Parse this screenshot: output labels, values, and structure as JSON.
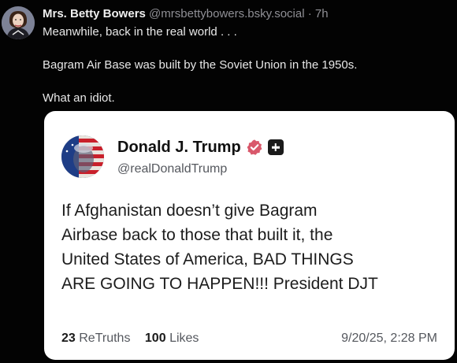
{
  "post": {
    "author_name": "Mrs. Betty Bowers",
    "author_handle": "@mrsbettybowers.bsky.social",
    "separator": "·",
    "time": "7h",
    "lines": [
      "Meanwhile, back in the real world . . .",
      "Bagram Air Base was built by the Soviet Union in the 1950s.",
      "What an idiot."
    ]
  },
  "quote": {
    "name": "Donald J. Trump",
    "handle": "@realDonaldTrump",
    "text_lines": [
      "If Afghanistan doesn’t give Bagram",
      "Airbase back to those that built it, the",
      "United States of America, BAD THINGS",
      "ARE GOING TO HAPPEN!!! President DJT"
    ],
    "retruths_count": "23",
    "retruths_label": "ReTruths",
    "likes_count": "100",
    "likes_label": "Likes",
    "date": "9/20/25, 2:28 PM"
  },
  "colors": {
    "background": "#030303",
    "card": "#ffffff",
    "verified_badge": "#d9586b"
  },
  "icons": {
    "verified": "verified-badge-icon",
    "plus": "plus-icon"
  }
}
